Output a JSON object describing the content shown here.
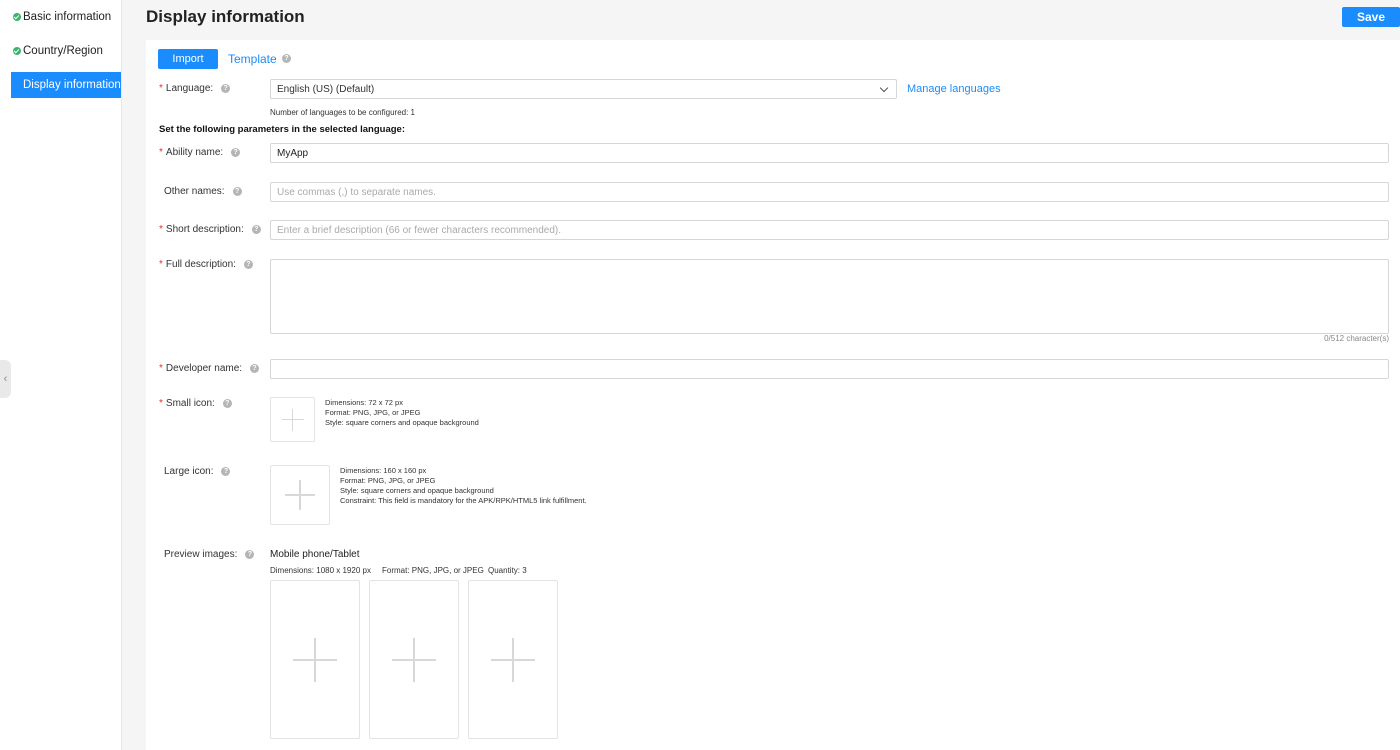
{
  "sidebar": {
    "items": [
      {
        "label": "Basic information",
        "completed": true
      },
      {
        "label": "Country/Region",
        "completed": true
      },
      {
        "label": "Display information",
        "active": true
      }
    ]
  },
  "header": {
    "title": "Display information",
    "save_label": "Save"
  },
  "toolbar": {
    "import_label": "Import",
    "template_label": "Template"
  },
  "language": {
    "label": "Language:",
    "value": "English (US) (Default)",
    "manage_label": "Manage languages",
    "count_note": "Number of languages to be configured: 1"
  },
  "section_heading": "Set the following parameters in the selected language:",
  "fields": {
    "ability_name": {
      "label": "Ability name:",
      "value": "MyApp"
    },
    "other_names": {
      "label": "Other names:",
      "placeholder": "Use commas (,) to separate names."
    },
    "short_description": {
      "label": "Short description:",
      "placeholder": "Enter a brief description (66 or fewer characters recommended)."
    },
    "full_description": {
      "label": "Full description:",
      "counter": "0/512 character(s)"
    },
    "developer_name": {
      "label": "Developer name:"
    }
  },
  "small_icon": {
    "label": "Small icon:",
    "info": [
      "Dimensions: 72 x 72 px",
      "Format: PNG, JPG, or JPEG",
      "Style: square corners and opaque background"
    ]
  },
  "large_icon": {
    "label": "Large icon:",
    "info": [
      "Dimensions: 160 x 160 px",
      "Format: PNG, JPG, or JPEG",
      "Style: square corners and opaque background",
      "Constraint: This field is mandatory for the APK/RPK/HTML5 link fulfillment."
    ]
  },
  "preview": {
    "label": "Preview images:",
    "device": "Mobile phone/Tablet",
    "dimensions": "Dimensions: 1080 x 1920 px",
    "format": "Format: PNG, JPG, or JPEG",
    "quantity": "Quantity: 3"
  },
  "colors": {
    "accent": "#1a8cfd",
    "required": "#e03030",
    "success": "#3cb371"
  }
}
